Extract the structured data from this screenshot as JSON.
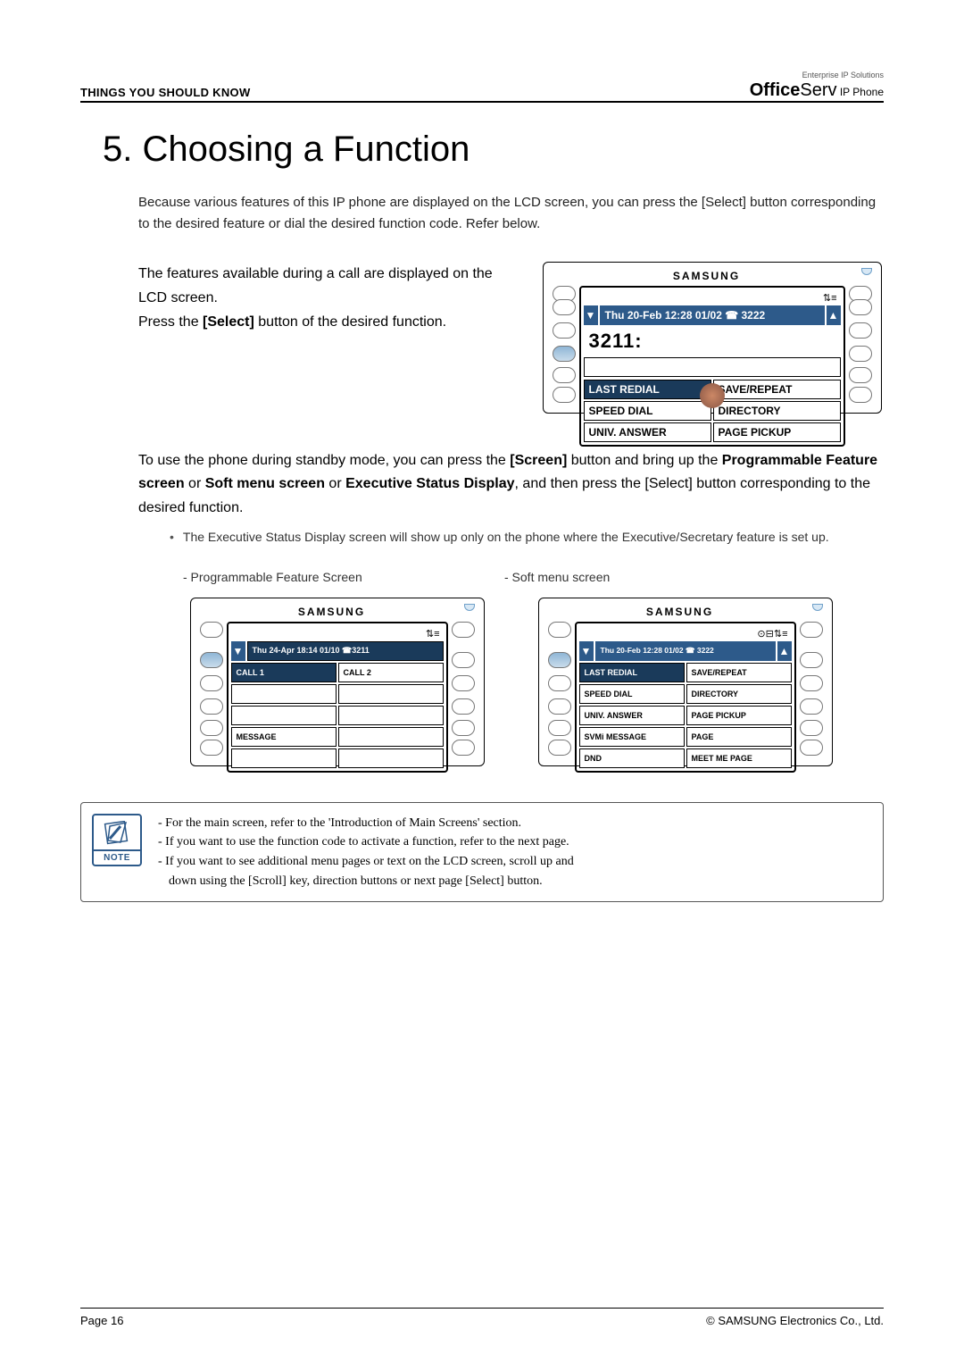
{
  "header": {
    "left": "THINGS YOU SHOULD KNOW",
    "right_tagline": "Enterprise IP Solutions",
    "brand_bold": "Office",
    "brand_rest": "Serv",
    "brand_suffix": " IP Phone"
  },
  "title": "5. Choosing a Function",
  "intro": "Because various features of this IP phone are displayed on the LCD screen, you can press the [Select] button corresponding to the desired feature or dial the desired function code. Refer below.",
  "left_text_1": "The features available during a call are displayed on the LCD screen.",
  "left_text_2_pre": "Press the ",
  "left_text_2_bold": "[Select]",
  "left_text_2_post": " button of the desired function.",
  "main_screen": {
    "brand": "SAMSUNG",
    "status_icon": "⇅≡",
    "date_bar": "Thu 20-Feb 12:28  01/02 ☎ 3222",
    "big": "3211:",
    "rows": [
      [
        "LAST REDIAL",
        "SAVE/REPEAT"
      ],
      [
        "SPEED DIAL",
        "DIRECTORY"
      ],
      [
        "UNIV. ANSWER",
        "PAGE PICKUP"
      ]
    ],
    "scroll_down": "▼",
    "scroll_up": "▲"
  },
  "para2_pre": "To use the phone during standby mode, you can press the ",
  "para2_b1": "[Screen]",
  "para2_mid1": " button and bring up the ",
  "para2_b2": "Programmable Feature screen",
  "para2_or1": " or ",
  "para2_b3": "Soft menu screen",
  "para2_or2": " or ",
  "para2_b4": "Executive Status Display",
  "para2_post": ", and then press the [Select] button corresponding to the desired function.",
  "bullet_text": "The Executive Status Display screen will show up only on the phone where the Executive/Secretary feature is set up.",
  "bullet_dot": "•",
  "caption_left": "- Programmable Feature Screen",
  "caption_right": "- Soft menu screen",
  "prog_screen": {
    "brand": "SAMSUNG",
    "status_icon": "⇅≡",
    "date_bar": "Thu 24-Apr  18:14  01/10 ☎3211",
    "rows": [
      [
        "CALL 1",
        "CALL 2"
      ],
      [
        "",
        ""
      ],
      [
        "",
        ""
      ],
      [
        "MESSAGE",
        ""
      ],
      [
        "",
        ""
      ]
    ],
    "scroll_down": "▼"
  },
  "soft_screen": {
    "brand": "SAMSUNG",
    "status_icon": "⊙⊟⇅≡",
    "date_bar": "Thu 20-Feb 12:28  01/02 ☎ 3222",
    "rows": [
      [
        "LAST REDIAL",
        "SAVE/REPEAT"
      ],
      [
        "SPEED DIAL",
        "DIRECTORY"
      ],
      [
        "UNIV. ANSWER",
        "PAGE PICKUP"
      ],
      [
        "SVMi MESSAGE",
        "PAGE"
      ],
      [
        "DND",
        "MEET ME PAGE"
      ]
    ],
    "scroll_down": "▼",
    "scroll_up": "▲"
  },
  "note": {
    "label": "NOTE",
    "line1": "- For the main screen, refer to the 'Introduction of Main Screens' section.",
    "line2": "- If you want to use the function code to activate a function, refer to the next page.",
    "line3": "- If you want to see additional menu pages or text on the LCD screen, scroll up and",
    "line3b": "down using the [Scroll] key, direction buttons or next page [Select] button."
  },
  "footer": {
    "left": "Page 16",
    "right": "© SAMSUNG Electronics Co., Ltd."
  }
}
